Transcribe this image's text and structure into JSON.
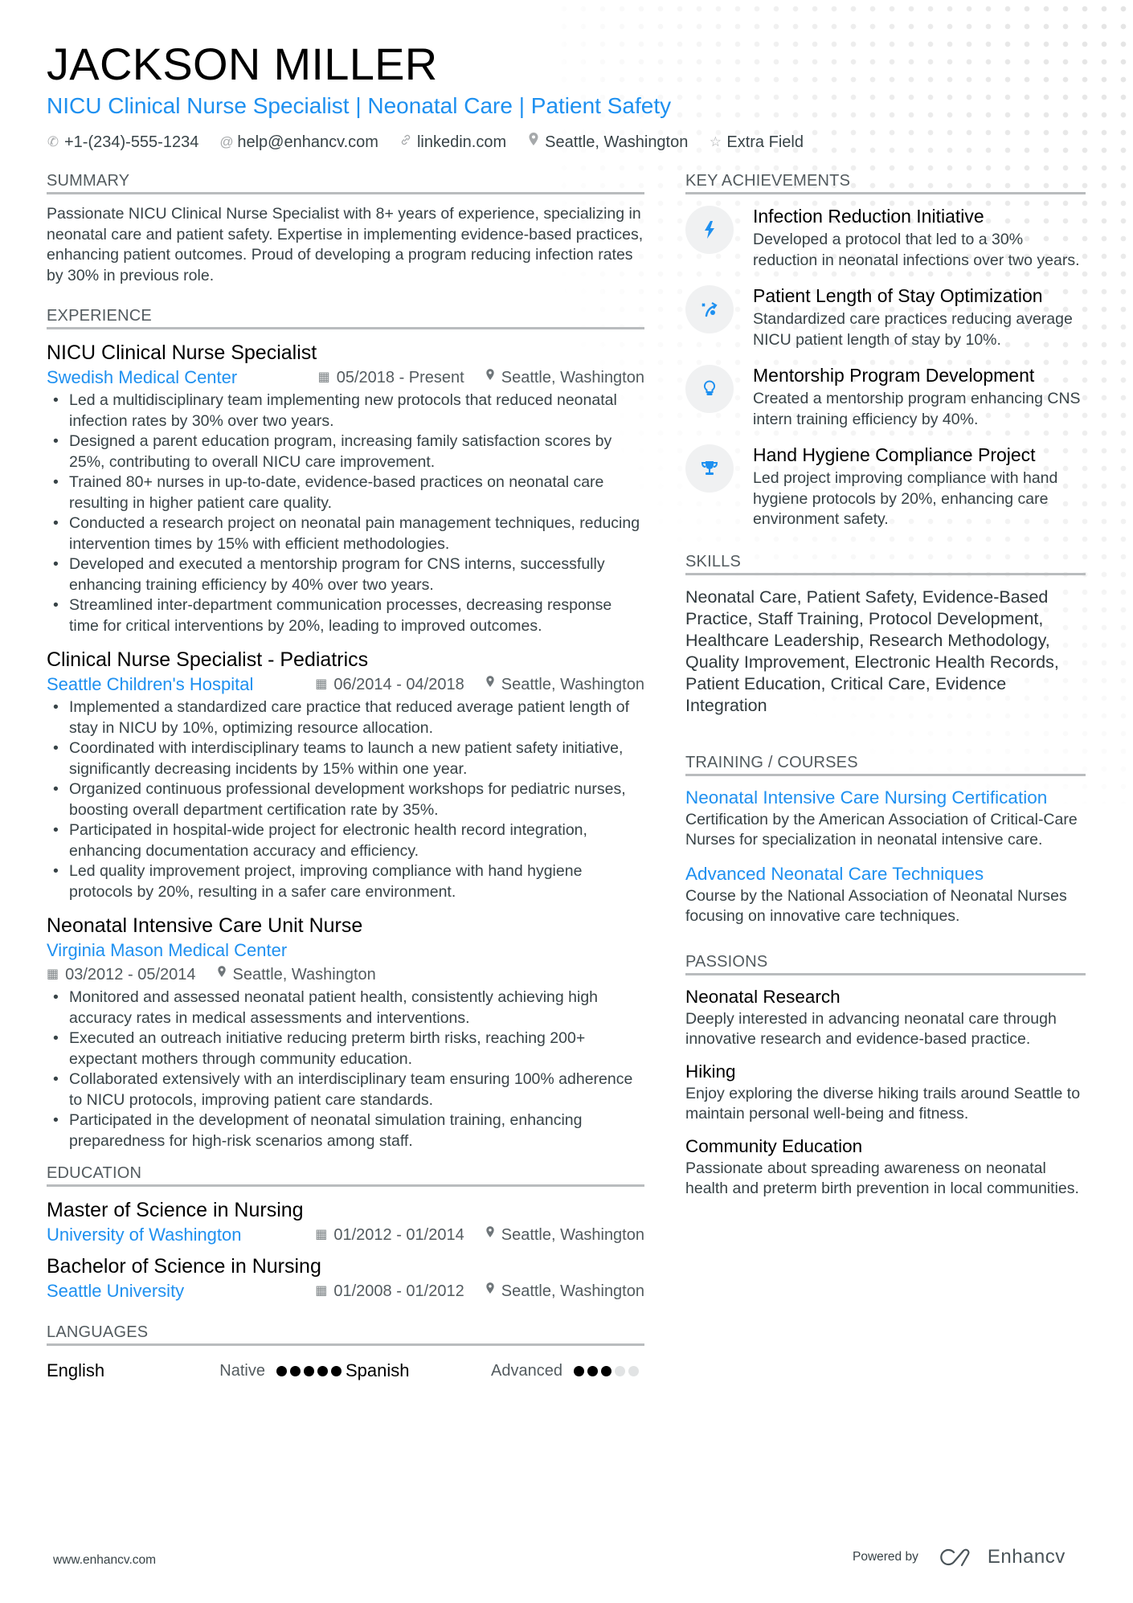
{
  "header": {
    "name": "JACKSON MILLER",
    "headline": "NICU Clinical Nurse Specialist | Neonatal Care | Patient Safety",
    "contacts": [
      {
        "icon": "phone-icon",
        "glyph": "✆",
        "text": "+1-(234)-555-1234"
      },
      {
        "icon": "at-icon",
        "glyph": "@",
        "text": "help@enhancv.com"
      },
      {
        "icon": "link-icon",
        "glyph": "🔗︎",
        "text": "linkedin.com"
      },
      {
        "icon": "location-pin-icon",
        "glyph": "⚲",
        "text": "Seattle, Washington"
      },
      {
        "icon": "star-icon",
        "glyph": "☆",
        "text": "Extra Field"
      }
    ]
  },
  "summary": {
    "title": "SUMMARY",
    "text": "Passionate NICU Clinical Nurse Specialist with 8+ years of experience, specializing in neonatal care and patient safety. Expertise in implementing evidence-based practices, enhancing patient outcomes. Proud of developing a program reducing infection rates by 30% in previous role."
  },
  "experience": {
    "title": "EXPERIENCE",
    "jobs": [
      {
        "title": "NICU Clinical Nurse Specialist",
        "company": "Swedish Medical Center",
        "dates": "05/2018 - Present",
        "location": "Seattle, Washington",
        "bullets": [
          "Led a multidisciplinary team implementing new protocols that reduced neonatal infection rates by 30% over two years.",
          "Designed a parent education program, increasing family satisfaction scores by 25%, contributing to overall NICU care improvement.",
          "Trained 80+ nurses in up-to-date, evidence-based practices on neonatal care resulting in higher patient care quality.",
          "Conducted a research project on neonatal pain management techniques, reducing intervention times by 15% with efficient methodologies.",
          "Developed and executed a mentorship program for CNS interns, successfully enhancing training efficiency by 40% over two years.",
          "Streamlined inter-department communication processes, decreasing response time for critical interventions by 20%, leading to improved outcomes."
        ]
      },
      {
        "title": "Clinical Nurse Specialist - Pediatrics",
        "company": "Seattle Children's Hospital",
        "dates": "06/2014 - 04/2018",
        "location": "Seattle, Washington",
        "bullets": [
          "Implemented a standardized care practice that reduced average patient length of stay in NICU by 10%, optimizing resource allocation.",
          "Coordinated with interdisciplinary teams to launch a new patient safety initiative, significantly decreasing incidents by 15% within one year.",
          "Organized continuous professional development workshops for pediatric nurses, boosting overall department certification rate by 35%.",
          "Participated in hospital-wide project for electronic health record integration, enhancing documentation accuracy and efficiency.",
          "Led quality improvement project, improving compliance with hand hygiene protocols by 20%, resulting in a safer care environment."
        ]
      },
      {
        "title": "Neonatal Intensive Care Unit Nurse",
        "company": "Virginia Mason Medical Center",
        "dates": "03/2012 - 05/2014",
        "location": "Seattle, Washington",
        "bullets": [
          "Monitored and assessed neonatal patient health, consistently achieving high accuracy rates in medical assessments and interventions.",
          "Executed an outreach initiative reducing preterm birth risks, reaching 200+ expectant mothers through community education.",
          "Collaborated extensively with an interdisciplinary team ensuring 100% adherence to NICU protocols, improving patient care standards.",
          "Participated in the development of neonatal simulation training, enhancing preparedness for high-risk scenarios among staff."
        ]
      }
    ]
  },
  "education": {
    "title": "EDUCATION",
    "items": [
      {
        "degree": "Master of Science in Nursing",
        "school": "University of Washington",
        "dates": "01/2012 - 01/2014",
        "location": "Seattle, Washington"
      },
      {
        "degree": "Bachelor of Science in Nursing",
        "school": "Seattle University",
        "dates": "01/2008 - 01/2012",
        "location": "Seattle, Washington"
      }
    ]
  },
  "languages": {
    "title": "LANGUAGES",
    "items": [
      {
        "name": "English",
        "level": "Native",
        "rating": 5,
        "max": 5
      },
      {
        "name": "Spanish",
        "level": "Advanced",
        "rating": 3,
        "max": 5
      }
    ]
  },
  "achievements": {
    "title": "KEY ACHIEVEMENTS",
    "items": [
      {
        "icon": "lightning-bolt-icon",
        "glyph": "ϟ",
        "title": "Infection Reduction Initiative",
        "desc": "Developed a protocol that led to a 30% reduction in neonatal infections over two years."
      },
      {
        "icon": "strategy-arrow-icon",
        "glyph": "⤴",
        "title": "Patient Length of Stay Optimization",
        "desc": "Standardized care practices reducing average NICU patient length of stay by 10%."
      },
      {
        "icon": "lightbulb-icon",
        "glyph": "💡︎",
        "title": "Mentorship Program Development",
        "desc": "Created a mentorship program enhancing CNS intern training efficiency by 40%."
      },
      {
        "icon": "trophy-icon",
        "glyph": "🏆︎",
        "title": "Hand Hygiene Compliance Project",
        "desc": "Led project improving compliance with hand hygiene protocols by 20%, enhancing care environment safety."
      }
    ]
  },
  "skills": {
    "title": "SKILLS",
    "text": "Neonatal Care, Patient Safety, Evidence-Based Practice, Staff Training, Protocol Development, Healthcare Leadership, Research Methodology, Quality Improvement, Electronic Health Records, Patient Education, Critical Care, Evidence Integration"
  },
  "training": {
    "title": "TRAINING / COURSES",
    "items": [
      {
        "title": "Neonatal Intensive Care Nursing Certification",
        "desc": "Certification by the American Association of Critical-Care Nurses for specialization in neonatal intensive care."
      },
      {
        "title": "Advanced Neonatal Care Techniques",
        "desc": "Course by the National Association of Neonatal Nurses focusing on innovative care techniques."
      }
    ]
  },
  "passions": {
    "title": "PASSIONS",
    "items": [
      {
        "title": "Neonatal Research",
        "desc": "Deeply interested in advancing neonatal care through innovative research and evidence-based practice."
      },
      {
        "title": "Hiking",
        "desc": "Enjoy exploring the diverse hiking trails around Seattle to maintain personal well-being and fitness."
      },
      {
        "title": "Community Education",
        "desc": "Passionate about spreading awareness on neonatal health and preterm birth prevention in local communities."
      }
    ]
  },
  "footer": {
    "website": "www.enhancv.com",
    "powered_by": "Powered by",
    "brand": "Enhancv"
  },
  "colors": {
    "accent": "#1e90f0",
    "text": "#384347",
    "heading": "#000000",
    "rule": "#b9bcbe"
  }
}
